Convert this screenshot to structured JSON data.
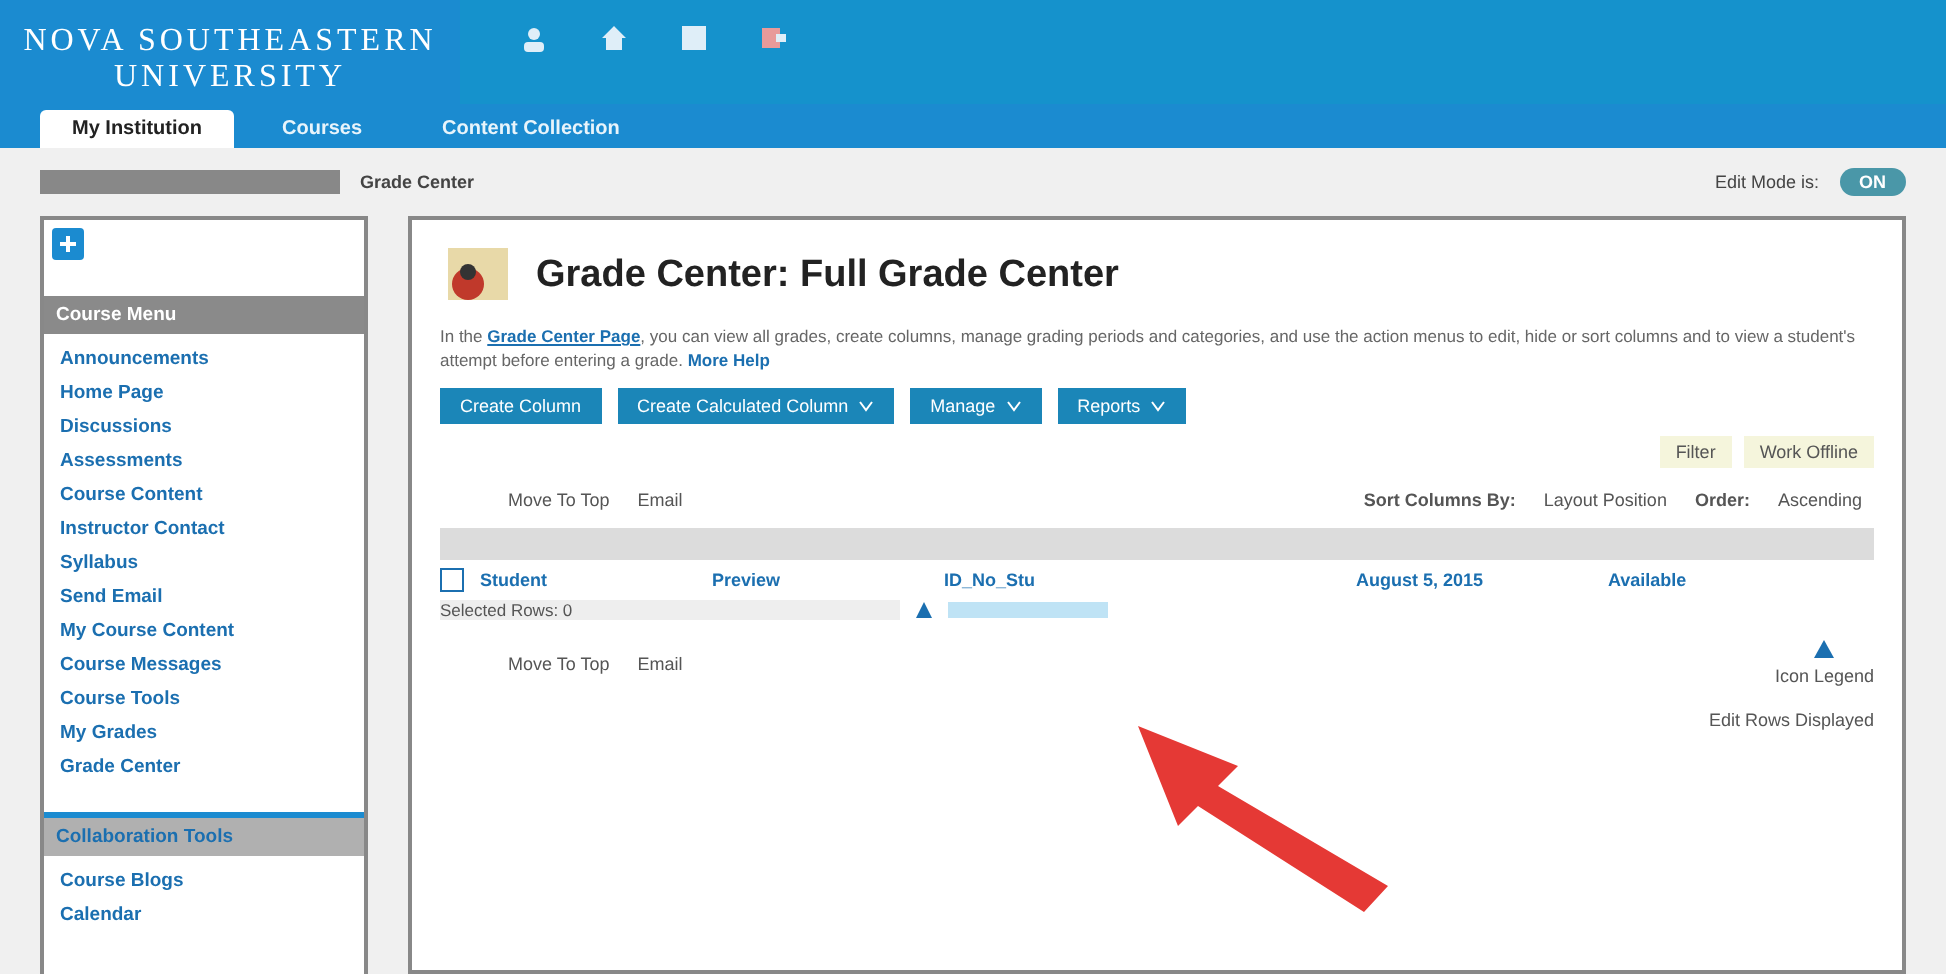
{
  "header": {
    "logo_line_1": "NOVA SOUTHEASTERN",
    "logo_line_2": "UNIVERSITY"
  },
  "tabs": [
    {
      "label": "My Institution",
      "selected": true
    },
    {
      "label": "Courses",
      "selected": false
    },
    {
      "label": "Content Collection",
      "selected": false
    }
  ],
  "breadcrumb": {
    "current": "Grade Center"
  },
  "edit_mode": {
    "label": "Edit Mode is:",
    "value": "ON",
    "on": true
  },
  "sidebar": {
    "sections": [
      {
        "title": "Course Menu",
        "items": [
          "Announcements",
          "Home Page",
          "Discussions",
          "Assessments",
          "Course Content",
          "Instructor Contact",
          "Syllabus",
          "Send Email",
          "My Course Content",
          "Course Messages",
          "Course Tools",
          "My Grades",
          "Grade Center"
        ]
      },
      {
        "title": "Collaboration Tools",
        "items": [
          "Course Blogs",
          "Calendar"
        ]
      }
    ]
  },
  "main": {
    "title": "Grade Center: Full Grade Center",
    "description_before": "In the ",
    "description_link": "Grade Center Page",
    "description_after": ", you can view all grades, create columns, manage grading periods and categories, and use the action menus to edit, hide or sort columns and to view a student's attempt before entering a grade.",
    "help_link": "More Help",
    "buttons": [
      "Create Column",
      "Create Calculated Column",
      "Manage",
      "Reports"
    ],
    "right_links": [
      "Filter",
      "Work Offline"
    ],
    "actions": [
      "Move To Top",
      "Email"
    ],
    "bottom_actions": [
      "Move To Top",
      "Email"
    ],
    "sort": {
      "label": "Sort Columns By:",
      "value": "Layout Position",
      "order_label": "Order:",
      "order_value": "Ascending"
    },
    "row": {
      "checked": false,
      "cells": [
        "Student",
        "Preview",
        "ID_No_Stu",
        "August 5, 2015",
        "Available"
      ]
    },
    "selected_rows": "Selected Rows: 0",
    "icon_legend": "Icon Legend",
    "edit_rows": "Edit Rows Displayed"
  }
}
